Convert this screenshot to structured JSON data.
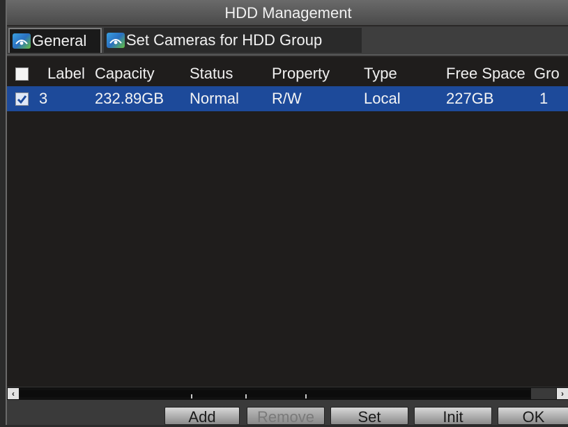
{
  "window": {
    "title": "HDD Management"
  },
  "tabs": [
    {
      "label": "General",
      "active": true,
      "icon": "network-icon"
    },
    {
      "label": "Set Cameras for HDD Group",
      "active": false,
      "icon": "network-icon"
    }
  ],
  "table": {
    "columns": [
      "Label",
      "Capacity",
      "Status",
      "Property",
      "Type",
      "Free Space",
      "Gro"
    ],
    "rows": [
      {
        "checked": true,
        "label": "3",
        "capacity": "232.89GB",
        "status": "Normal",
        "property": "R/W",
        "type": "Local",
        "free_space": "227GB",
        "group": "1"
      }
    ]
  },
  "scrollbar": {
    "left_arrow": "‹",
    "right_arrow": "›"
  },
  "buttons": {
    "add": "Add",
    "remove": "Remove",
    "set": "Set",
    "init": "Init",
    "ok": "OK"
  },
  "colors": {
    "selected_row": "#1d4a9a",
    "background": "#1f1d1c",
    "titlebar": "#5a5a5a"
  }
}
